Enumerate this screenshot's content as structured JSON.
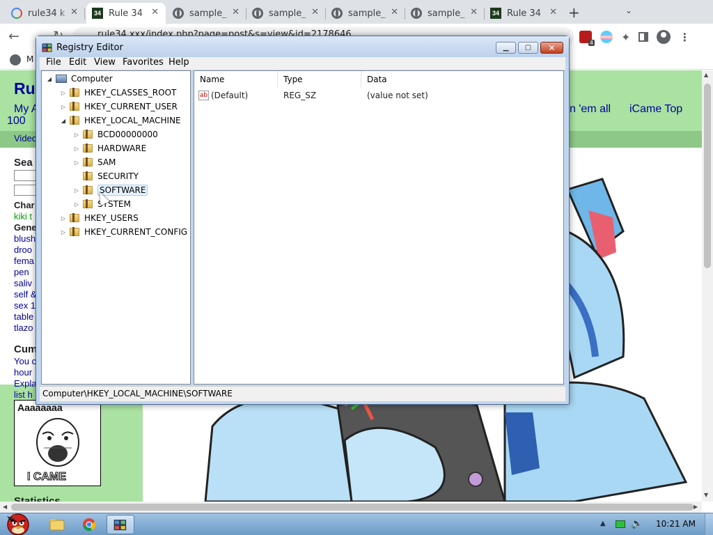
{
  "browser": {
    "tabs": [
      {
        "title": "rule34 k",
        "favicon": "google-g-icon",
        "active": false
      },
      {
        "title": "Rule 34",
        "favicon": "rule34-icon",
        "active": true
      },
      {
        "title": "sample_",
        "favicon": "globe-icon",
        "active": false
      },
      {
        "title": "sample_",
        "favicon": "globe-icon",
        "active": false
      },
      {
        "title": "sample_",
        "favicon": "globe-icon",
        "active": false
      },
      {
        "title": "sample_",
        "favicon": "globe-icon",
        "active": false
      },
      {
        "title": "Rule 34",
        "favicon": "rule34-icon",
        "active": false
      }
    ],
    "url": "rule34.xxx/index.php?page=post&s=view&id=2178646",
    "extension_badge": "4",
    "bookmark_label": "M"
  },
  "page": {
    "site_title": "Rul",
    "nav_left": "My A",
    "nav_100": "100",
    "nav_all": "n 'em all",
    "nav_icame": "iCame Top",
    "subnav": "Video",
    "search_heading": "Sea",
    "char_heading": "Char",
    "char_tag": "kiki t",
    "general_heading": "Gene",
    "general_tags": [
      "blush",
      "droo",
      "fema",
      "pen",
      "saliv",
      "self &",
      "sex 1",
      "table",
      "tlazo"
    ],
    "cum_heading": "Cum",
    "cum_lines": [
      "You c",
      "hour",
      "Expla",
      "list h"
    ],
    "icame_top": "Aaaaaaaa",
    "icame_bottom": "I CAME",
    "stats_heading": "Statistics"
  },
  "regedit": {
    "title": "Registry Editor",
    "menus": [
      "File",
      "Edit",
      "View",
      "Favorites",
      "Help"
    ],
    "tree": {
      "root": "Computer",
      "hives": [
        "HKEY_CLASSES_ROOT",
        "HKEY_CURRENT_USER",
        "HKEY_LOCAL_MACHINE",
        "HKEY_USERS",
        "HKEY_CURRENT_CONFIG"
      ],
      "hklm_children": [
        "BCD00000000",
        "HARDWARE",
        "SAM",
        "SECURITY",
        "SOFTWARE",
        "SYSTEM"
      ],
      "selected": "SOFTWARE"
    },
    "columns": [
      "Name",
      "Type",
      "Data"
    ],
    "values": [
      {
        "name": "(Default)",
        "type": "REG_SZ",
        "data": "(value not set)"
      }
    ],
    "status": "Computer\\HKEY_LOCAL_MACHINE\\SOFTWARE"
  },
  "taskbar": {
    "clock": "10:21 AM",
    "apps": [
      "explorer",
      "chrome",
      "regedit"
    ],
    "active_app": "regedit"
  },
  "colors": {
    "site_green": "#a9e2a1",
    "link_blue": "#00009c",
    "win7_title": "#c2d7ef",
    "taskbar": "#6c9bc6"
  }
}
